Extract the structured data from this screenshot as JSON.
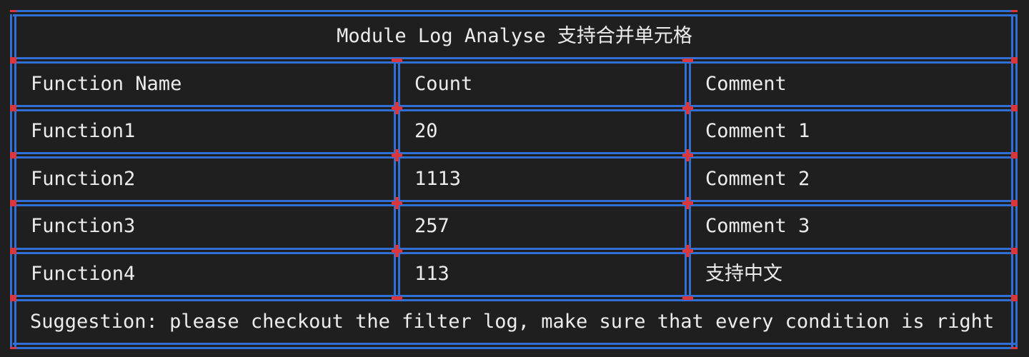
{
  "colors": {
    "background": "#1f1f1f",
    "border_blue": "#2f6fd6",
    "joint_red": "#d9363e",
    "text": "#ececec"
  },
  "table": {
    "title": "Module Log Analyse 支持合并单元格",
    "headers": [
      "Function Name",
      "Count",
      "Comment"
    ],
    "rows": [
      [
        "Function1",
        "20",
        "Comment 1"
      ],
      [
        "Function2",
        "1113",
        "Comment 2"
      ],
      [
        "Function3",
        "257",
        "Comment 3"
      ],
      [
        "Function4",
        "113",
        "支持中文"
      ]
    ],
    "footer": "Suggestion: please checkout the filter log, make sure that every condition is right"
  }
}
